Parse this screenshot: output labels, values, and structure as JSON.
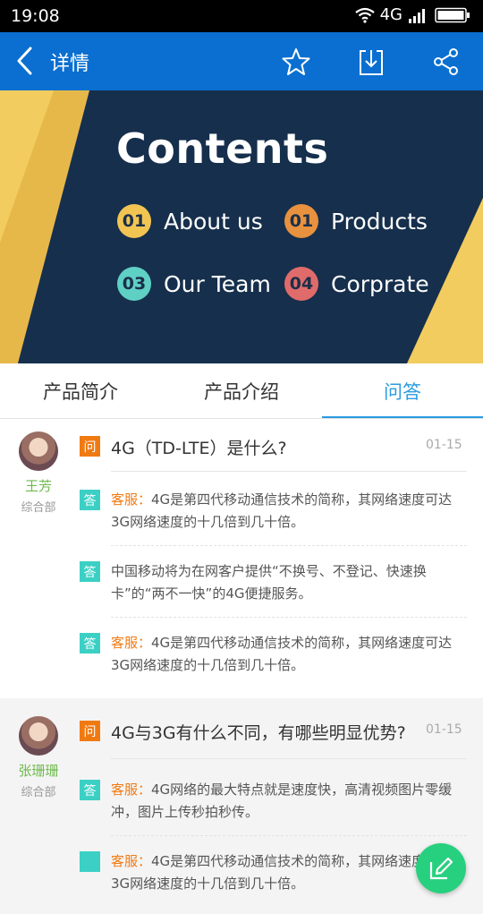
{
  "status_bar": {
    "time": "19:08",
    "network": "4G"
  },
  "nav": {
    "title": "详情",
    "icons": [
      "back-arrow-icon",
      "star-icon",
      "download-icon",
      "share-icon"
    ]
  },
  "banner": {
    "heading": "Contents",
    "items": [
      {
        "num": "01",
        "label": "About us",
        "color": "#f2c552"
      },
      {
        "num": "01",
        "label": "Products",
        "color": "#e8913e"
      },
      {
        "num": "03",
        "label": "Our Team",
        "color": "#5fd0c4"
      },
      {
        "num": "04",
        "label": "Corprate",
        "color": "#e06b6b"
      }
    ],
    "colors": {
      "panel": "#162f4d",
      "background": "#f2cc5e"
    }
  },
  "tabs": [
    {
      "label": "产品简介"
    },
    {
      "label": "产品介绍"
    },
    {
      "label": "问答"
    }
  ],
  "active_tab": 2,
  "threads": [
    {
      "author": "王芳",
      "dept": "综合部",
      "q_badge": "问",
      "question": "4G（TD-LTE）是什么?",
      "date": "01-15",
      "answers": [
        {
          "badge": "答",
          "who": "客服：",
          "text": "4G是第四代移动通信技术的简称，其网络速度可达3G网络速度的十几倍到几十倍。"
        },
        {
          "badge": "答",
          "who": "",
          "text": "中国移动将为在网客户提供“不换号、不登记、快速换卡”的“两不一快”的4G便捷服务。"
        },
        {
          "badge": "答",
          "who": "客服：",
          "text": "4G是第四代移动通信技术的简称，其网络速度可达3G网络速度的十几倍到几十倍。"
        }
      ]
    },
    {
      "author": "张珊珊",
      "dept": "综合部",
      "q_badge": "问",
      "question": "4G与3G有什么不同，有哪些明显优势?",
      "date": "01-15",
      "answers": [
        {
          "badge": "答",
          "who": "客服：",
          "text": "4G网络的最大特点就是速度快，高清视频图片零缓冲，图片上传秒拍秒传。"
        },
        {
          "badge": "",
          "who": "客服：",
          "text": "4G是第四代移动通信技术的简称，其网络速度可达3G网络速度的十几倍到几十倍。"
        }
      ]
    }
  ],
  "fab": {
    "icon": "edit-icon"
  }
}
